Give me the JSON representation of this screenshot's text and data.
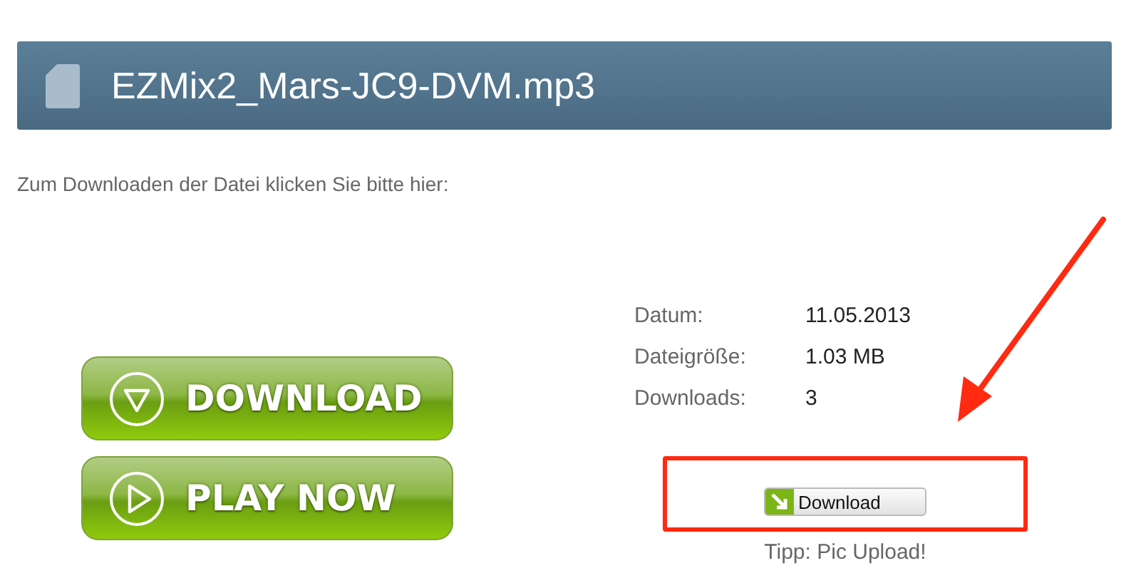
{
  "header": {
    "title": "EZMix2_Mars-JC9-DVM.mp3"
  },
  "instruction": "Zum Downloaden der Datei klicken Sie bitte hier:",
  "promo_buttons": [
    {
      "kind": "download",
      "label": "DOWNLOAD"
    },
    {
      "kind": "play",
      "label": "PLAY NOW"
    }
  ],
  "file_info": [
    {
      "label": "Datum:",
      "value": "11.05.2013"
    },
    {
      "label": "Dateigröße:",
      "value": "1.03 MB"
    },
    {
      "label": "Downloads:",
      "value": "3"
    }
  ],
  "download_button": {
    "label": "Download"
  },
  "tip": "Tipp: Pic Upload!"
}
